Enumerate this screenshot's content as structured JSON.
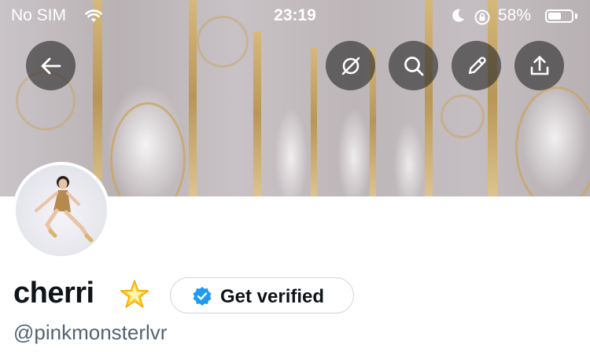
{
  "status_bar": {
    "carrier": "No SIM",
    "time": "23:19",
    "battery_percent": "58%",
    "battery_level": 0.58,
    "icons": [
      "wifi-icon",
      "moon-icon",
      "orientation-lock-icon",
      "battery-icon"
    ]
  },
  "header": {
    "buttons": [
      "back-arrow-icon",
      "circle-slash-icon",
      "search-icon",
      "pencil-icon",
      "share-upload-icon"
    ]
  },
  "profile": {
    "display_name": "cherri",
    "emoji": "glowing-star-icon",
    "handle": "@pinkmonsterlvr",
    "get_verified_label": "Get verified",
    "verified_badge_color": "#1d9bf0"
  },
  "colors": {
    "primary_text": "#0f1419",
    "secondary_text": "#536471",
    "border": "#cfd9de",
    "overlay_button": "rgba(40,40,40,0.62)"
  }
}
